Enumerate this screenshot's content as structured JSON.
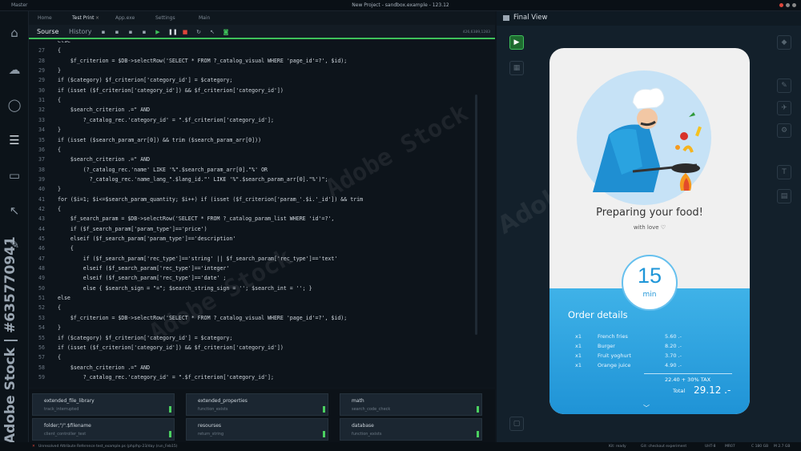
{
  "window": {
    "app_name": "Master",
    "title": "New Project - sandbox.example - 123.12"
  },
  "tabs": [
    "Home",
    "Test Print",
    "App.exe",
    "Settings",
    "Main"
  ],
  "tab_close": "×",
  "toolbar": {
    "source": "Sourse",
    "history": "History",
    "position": "426,6389,1283"
  },
  "code_lines": [
    {
      "n": "",
      "t": "else"
    },
    {
      "n": "27",
      "t": "{"
    },
    {
      "n": "28",
      "t": "    $f_criterion = $DB->selectRow('SELECT * FROM ?_catalog_visual WHERE 'page_id'=?', $id);"
    },
    {
      "n": "29",
      "t": "}"
    },
    {
      "n": "29",
      "t": "if ($category) $f_criterion['category_id'] = $category;"
    },
    {
      "n": "30",
      "t": "if (isset ($f_criterion['category_id']) && $f_criterion['category_id'])"
    },
    {
      "n": "31",
      "t": "{"
    },
    {
      "n": "32",
      "t": "    $search_criterion .=\" AND"
    },
    {
      "n": "33",
      "t": "        ?_catalog_rec.'category_id' = \".$f_criterion['category_id'];"
    },
    {
      "n": "34",
      "t": "}"
    },
    {
      "n": "35",
      "t": "if (isset ($search_param_arr[0]) && trim ($search_param_arr[0]))"
    },
    {
      "n": "36",
      "t": "{"
    },
    {
      "n": "37",
      "t": "    $search_criterion .=\" AND"
    },
    {
      "n": "38",
      "t": "        (?_catalog_rec.'name' LIKE '%\".$search_param_arr[0].\"%' OR"
    },
    {
      "n": "39",
      "t": "          ?_catalog_rec.'name_lang_\".$lang_id.\"' LIKE '%\".$search_param_arr[0].\"%')\";"
    },
    {
      "n": "40",
      "t": "}"
    },
    {
      "n": "41",
      "t": "for ($i=1; $i<=$search_param_quantity; $i++) if (isset ($f_criterion['param_'.$i.'_id']) && trim"
    },
    {
      "n": "42",
      "t": "{"
    },
    {
      "n": "43",
      "t": "    $f_search_param = $DB->selectRow('SELECT * FROM ?_catalog_param_list WHERE 'id'=?',"
    },
    {
      "n": "44",
      "t": "    if ($f_search_param['param_type']=='price')"
    },
    {
      "n": "45",
      "t": "    elseif ($f_search_param['param_type']=='description'"
    },
    {
      "n": "46",
      "t": "    {"
    },
    {
      "n": "47",
      "t": "        if ($f_search_param['rec_type']=='string' || $f_search_param['rec_type']=='text'"
    },
    {
      "n": "48",
      "t": "        elseif ($f_search_param['rec_type']=='integer'"
    },
    {
      "n": "49",
      "t": "        elseif ($f_search_param['rec_type']=='date' ;"
    },
    {
      "n": "50",
      "t": "        else { $search_sign = \"=\"; $search_string_sign = ''; $search_int = ''; }"
    },
    {
      "n": "51",
      "t": "else"
    },
    {
      "n": "52",
      "t": "{"
    },
    {
      "n": "53",
      "t": "    $f_criterion = $DB->selectRow('SELECT * FROM ?_catalog_visual WHERE 'page_id'=?', $id);"
    },
    {
      "n": "54",
      "t": "}"
    },
    {
      "n": "55",
      "t": "if ($category) $f_criterion['category_id'] = $category;"
    },
    {
      "n": "56",
      "t": "if (isset ($f_criterion['category_id']) && $f_criterion['category_id'])"
    },
    {
      "n": "57",
      "t": "{"
    },
    {
      "n": "58",
      "t": "    $search_criterion .=\" AND"
    },
    {
      "n": "59",
      "t": "        ?_catalog_rec.'category_id' = \".$f_criterion['category_id'];"
    }
  ],
  "panels": [
    {
      "name": "extended_file_library",
      "sub": "track_interrupted"
    },
    {
      "name": "extended_properties",
      "sub": "function_exists"
    },
    {
      "name": "math",
      "sub": "search_code_check"
    },
    {
      "name": "folder;\"/\".$filename",
      "sub": "client_controller_test"
    },
    {
      "name": "resourses",
      "sub": "return_string"
    },
    {
      "name": "database",
      "sub": "function_exists"
    }
  ],
  "status": {
    "left1": "Unresolved Attribute Reference",
    "left2": "test_example.ps (php/hp-23/day (run_Feb15)",
    "kit": "Kit: ready",
    "git": "Git: checkout experiment",
    "enc": "UHT-8",
    "mr": "MR07",
    "c": "C 180 GB",
    "m": "M 2.7 GB"
  },
  "right": {
    "title": "Final View"
  },
  "phone": {
    "title": "Preparing your food!",
    "subtitle": "with love",
    "timer_value": "15",
    "timer_unit": "min",
    "order_title": "Order details",
    "items": [
      {
        "qty": "x1",
        "name": "French fries",
        "price": "5.60 .-"
      },
      {
        "qty": "x1",
        "name": "Burger",
        "price": "8.20 .-"
      },
      {
        "qty": "x1",
        "name": "Fruit yoghurt",
        "price": "3.70 .-"
      },
      {
        "qty": "x1",
        "name": "Orange juice",
        "price": "4.90 .-"
      }
    ],
    "tax_line": "22.40   + 30% TAX",
    "total_label": "Total",
    "total_value": "29.12 .-"
  },
  "watermark": {
    "side": "Adobe Stock | #635770941",
    "text": "Adobe Stock"
  },
  "colors": {
    "accent": "#3ec05a",
    "phone_blue": "#2aa3e0"
  }
}
